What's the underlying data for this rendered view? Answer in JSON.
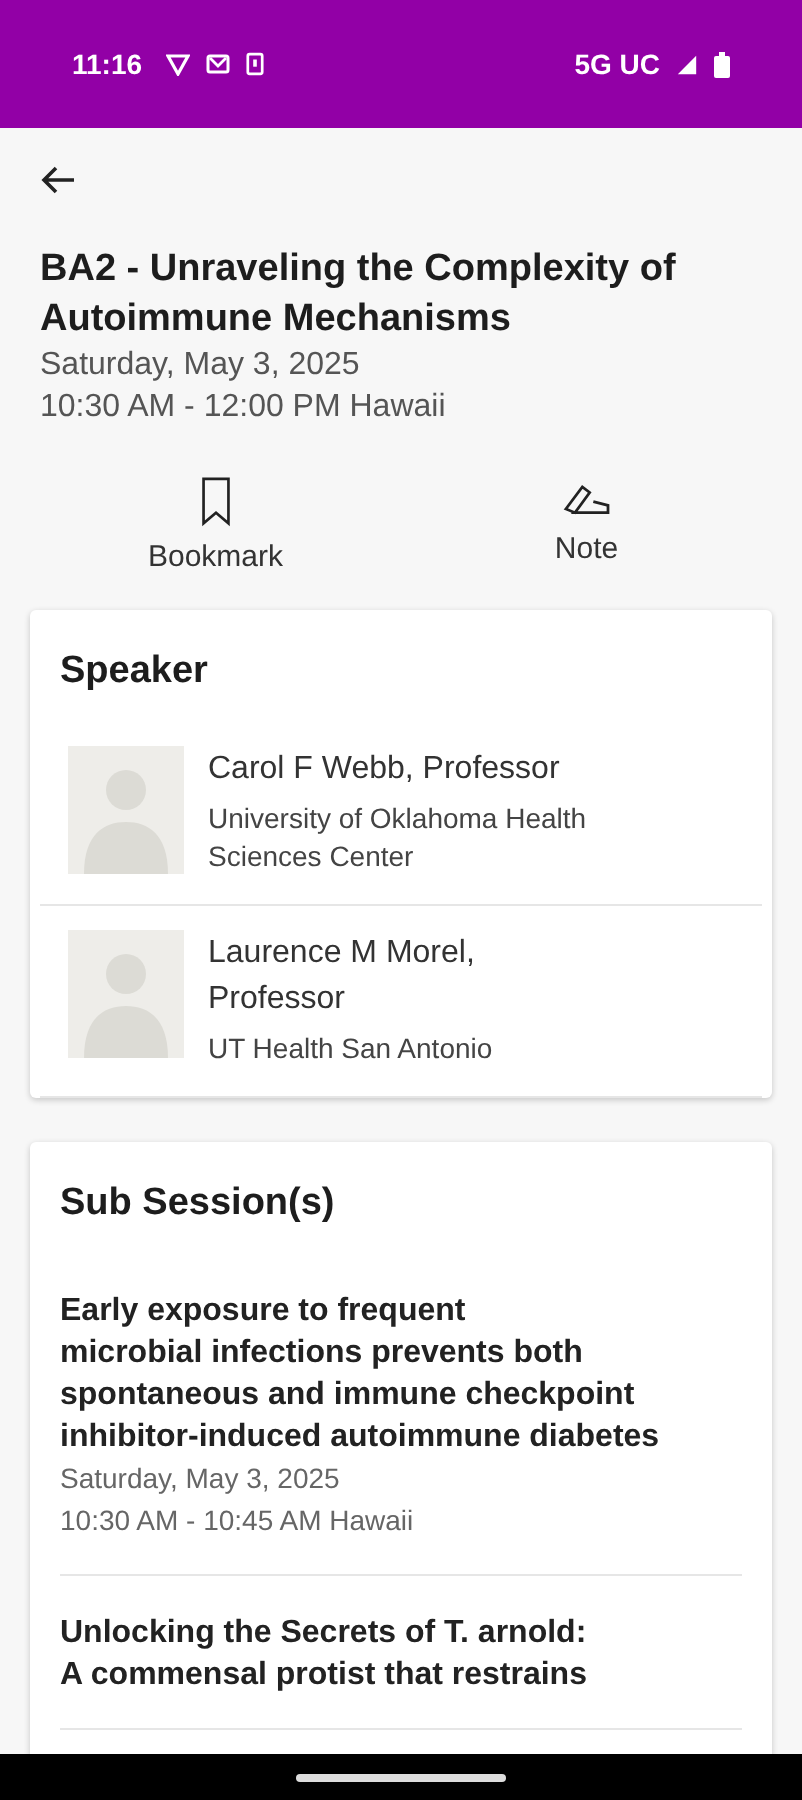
{
  "status_bar": {
    "time": "11:16",
    "network": "5G UC"
  },
  "session": {
    "title": "BA2 - Unraveling the Complexity of Autoimmune Mechanisms",
    "date": "Saturday, May 3, 2025",
    "time": "10:30 AM - 12:00 PM Hawaii"
  },
  "actions": [
    {
      "kind": "bookmark",
      "label": "Bookmark"
    },
    {
      "kind": "note",
      "label": "Note"
    }
  ],
  "speakers": {
    "heading": "Speaker",
    "items": [
      {
        "name": "Carol F Webb, Professor",
        "affiliation": "University of Oklahoma Health Sciences Center"
      },
      {
        "name": "Laurence M Morel,\nProfessor",
        "affiliation": "UT Health San Antonio"
      }
    ]
  },
  "sub_sessions": {
    "heading": "Sub Session(s)",
    "items": [
      {
        "title": "Early exposure to frequent\nmicrobial infections prevents both spontaneous and immune checkpoint inhibitor-induced autoimmune diabetes",
        "date": "Saturday, May 3, 2025",
        "time": "10:30 AM - 10:45 AM Hawaii"
      },
      {
        "title": "Unlocking the Secrets of T. arnold:\nA commensal protist that restrains"
      }
    ]
  }
}
